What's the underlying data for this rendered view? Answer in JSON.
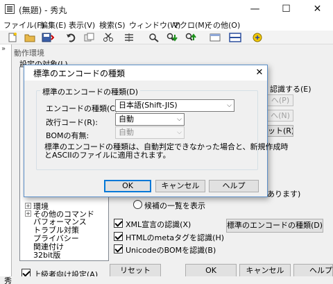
{
  "window": {
    "title": "(無題) - 秀丸",
    "minimize": "—",
    "maximize": "☐",
    "close": "✕"
  },
  "menubar": {
    "items": [
      {
        "label": "ファイル(F)"
      },
      {
        "label": "編集(E)"
      },
      {
        "label": "表示(V)"
      },
      {
        "label": "検索(S)"
      },
      {
        "label": "ウィンドウ(W)"
      },
      {
        "label": "マクロ(M)"
      },
      {
        "label": "その他(O)"
      }
    ]
  },
  "toolbar": {
    "buttons": [
      "new-file-icon",
      "open-folder-icon",
      "save-icon",
      "undo-icon",
      "copy-icon",
      "cut-icon",
      "paste-icon",
      "search-icon",
      "search-down-icon",
      "search-up-icon",
      "output-pane-icon",
      "window-split-icon",
      "macro-icon"
    ]
  },
  "left_margin_mark": "»",
  "settings": {
    "title": "動作環境",
    "target_label": "設定の対象(L)",
    "tree": [
      {
        "label": "環境",
        "expander": "+"
      },
      {
        "label": "その他のコマンド",
        "expander": "+"
      },
      {
        "label": "パフォーマンス"
      },
      {
        "label": "トラブル対策"
      },
      {
        "label": "プライバシー"
      },
      {
        "label": "関連付け"
      },
      {
        "label": "32bit版"
      }
    ],
    "right_partial": {
      "apply_label": "認識する(E)",
      "btn_prev": "へ(P)",
      "btn_next": "へ(N)",
      "btn_reset": "ット(R)",
      "wrap_text": "あります)"
    },
    "candidates_radio": "候補の一覧を表示",
    "checkboxes": [
      {
        "label": "XML宣言の認識(X)",
        "checked": true
      },
      {
        "label": "HTMLのmetaタグを認識(H)",
        "checked": true
      },
      {
        "label": "UnicodeのBOMを認識(B)",
        "checked": true
      }
    ],
    "encoding_kind_button": "標準のエンコードの種類(D)...",
    "advanced_checkbox": {
      "label": "上級者向け設定(A)",
      "checked": true
    },
    "reset_button": "リセット",
    "ok_button": "OK",
    "cancel_button": "キャンセル",
    "help_button": "ヘルプ"
  },
  "encoding_dialog": {
    "title": "標準のエンコードの種類",
    "close": "✕",
    "group_title": "標準のエンコードの種類(D)",
    "encoding_label": "エンコードの種類(C):",
    "encoding_value": "日本語(Shift-JIS)",
    "newline_label": "改行コード(R):",
    "newline_value": "自動",
    "bom_label": "BOMの有無:",
    "bom_value": "自動",
    "description_line1": "標準のエンコードの種類は、自動判定できなかった場合と、新規作成時",
    "description_line2": "とASCIIのファイルに適用されます。",
    "ok": "OK",
    "cancel": "キャンセル",
    "help": "ヘルプ"
  },
  "statusbar": {
    "text": "秀"
  },
  "colors": {
    "accent": "#0078d7",
    "dialog_bg": "#f0f0f0",
    "border": "#adadad"
  }
}
